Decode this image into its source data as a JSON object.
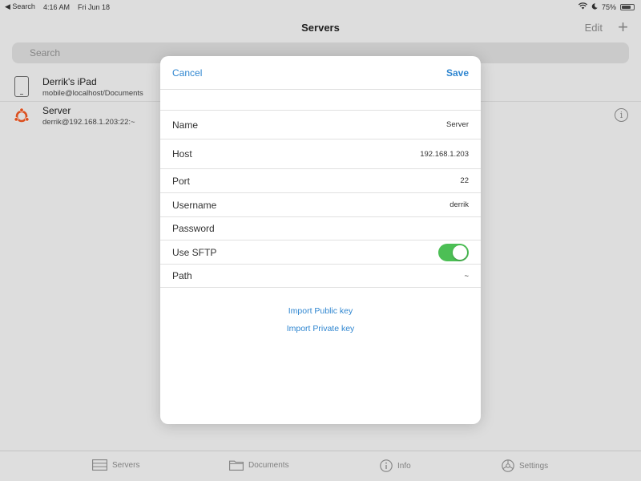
{
  "status_bar": {
    "back_label": "◀ Search",
    "time": "4:16 AM",
    "date": "Fri Jun 18",
    "battery_percent": "75%",
    "battery_level": 0.75
  },
  "navbar": {
    "title": "Servers",
    "edit_label": "Edit",
    "add_label": "+"
  },
  "search": {
    "placeholder": "Search"
  },
  "servers": [
    {
      "name": "Derrik's iPad",
      "address": "mobile@localhost/Documents",
      "icon": "ipad-icon"
    },
    {
      "name": "Server",
      "address": "derrik@192.168.1.203:22:~",
      "icon": "ubuntu-icon"
    }
  ],
  "info_label": "i",
  "modal": {
    "cancel_label": "Cancel",
    "save_label": "Save",
    "fields": {
      "name": {
        "label": "Name",
        "value": "Server"
      },
      "host": {
        "label": "Host",
        "value": "192.168.1.203"
      },
      "port": {
        "label": "Port",
        "value": "22"
      },
      "username": {
        "label": "Username",
        "value": "derrik"
      },
      "password": {
        "label": "Password",
        "value": ""
      },
      "use_sftp": {
        "label": "Use SFTP",
        "enabled": true
      },
      "path": {
        "label": "Path",
        "value": "~"
      }
    },
    "import_public_label": "Import Public key",
    "import_private_label": "Import Private key"
  },
  "tabbar": {
    "servers": "Servers",
    "documents": "Documents",
    "info": "Info",
    "settings": "Settings"
  },
  "colors": {
    "accent": "#2f86d0",
    "toggle_on": "#4cbf55",
    "ubuntu_orange": "#e95420"
  }
}
